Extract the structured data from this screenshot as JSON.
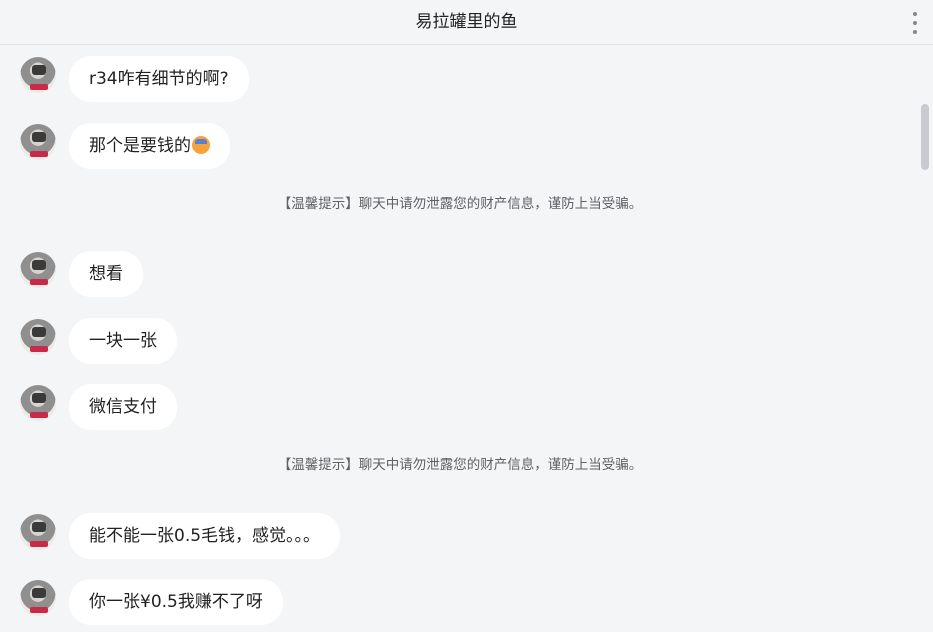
{
  "header": {
    "title": "易拉罐里的鱼"
  },
  "icons": {
    "more": "more-vertical-icon",
    "avatar": "user-avatar",
    "emoji": "sweat-face-emoji"
  },
  "messages": [
    {
      "text": "r34咋有细节的啊?"
    },
    {
      "text": "那个是要钱的",
      "emoji": "sweat-face-emoji"
    },
    {
      "text": "想看"
    },
    {
      "text": "一块一张"
    },
    {
      "text": "微信支付"
    },
    {
      "text": "能不能一张0.5毛钱，感觉。。。"
    },
    {
      "text": "你一张¥0.5我赚不了呀"
    }
  ],
  "notices": [
    {
      "text": "【温馨提示】聊天中请勿泄露您的财产信息，谨防上当受骗。"
    },
    {
      "text": "【温馨提示】聊天中请勿泄露您的财产信息，谨防上当受骗。"
    }
  ]
}
